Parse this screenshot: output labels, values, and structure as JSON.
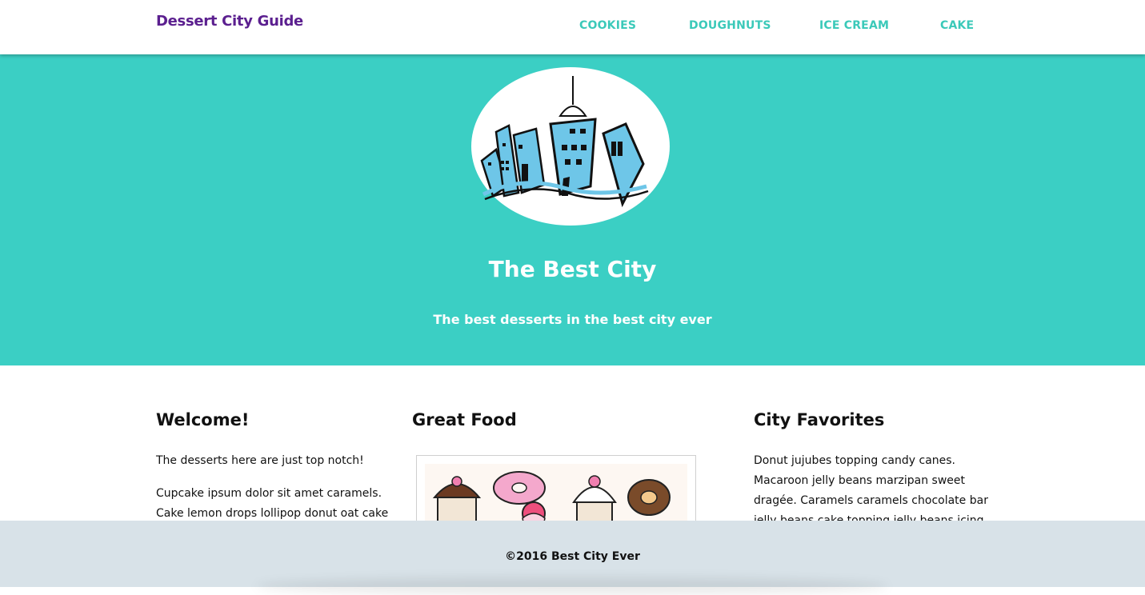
{
  "header": {
    "brand": "Dessert City Guide",
    "nav": [
      "COOKIES",
      "DOUGHNUTS",
      "ICE CREAM",
      "CAKE"
    ]
  },
  "hero": {
    "title": "The Best City",
    "subtitle": "The best desserts in the best city ever",
    "logo_icon": "city-skyline-icon"
  },
  "columns": {
    "welcome": {
      "title": "Welcome!",
      "para1": "The desserts here are just top notch!",
      "para2_line1": "Cupcake ipsum dolor sit amet caramels.",
      "para2_line2": "Cake lemon drops lollipop donut oat cake"
    },
    "food": {
      "title": "Great Food",
      "image_icon": "desserts-illustration-icon"
    },
    "favorites": {
      "title": "City Favorites",
      "line1": "Donut jujubes topping candy canes.",
      "line2": "Macaroon jelly beans marzipan sweet",
      "line3": "dragée. Caramels caramels chocolate bar",
      "line4": "jelly beans cake topping jelly beans icing"
    }
  },
  "footer": {
    "text": "©2016 Best City Ever"
  },
  "colors": {
    "accent": "#3bcfc4",
    "nav": "#3bc9b9",
    "brand": "#5b1f8f",
    "footer_bg": "#d8e2e8"
  }
}
